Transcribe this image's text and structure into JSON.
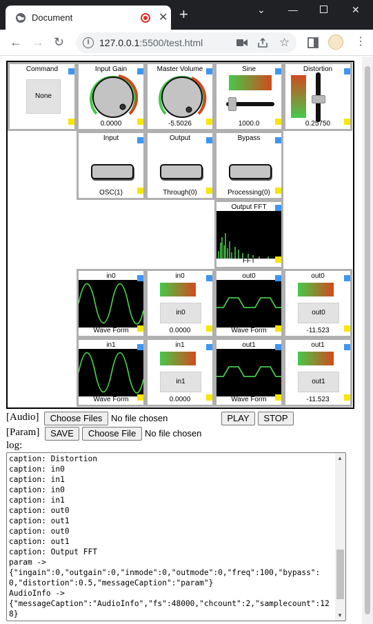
{
  "browser": {
    "tab_title": "Document",
    "url_host": "127.0.0.1",
    "url_rest": ":5500/test.html",
    "new_tab": "+",
    "close": "✕"
  },
  "cells": {
    "command": {
      "caption": "Command",
      "button": "None"
    },
    "input_gain": {
      "caption": "Input Gain",
      "value": "0.0000"
    },
    "master_volume": {
      "caption": "Master Volume",
      "value": "-5.5026"
    },
    "sine": {
      "caption": "Sine",
      "value": "1000.0"
    },
    "distortion": {
      "caption": "Distortion",
      "value": "0.25750"
    },
    "input": {
      "caption": "Input",
      "value": "OSC(1)"
    },
    "output": {
      "caption": "Output",
      "value": "Through(0)"
    },
    "bypass": {
      "caption": "Bypass",
      "value": "Processing(0)"
    },
    "output_fft": {
      "caption": "Output FFT",
      "label": "FFT"
    },
    "in0_wave": {
      "caption": "in0",
      "label": "Wave Form"
    },
    "in0_meter": {
      "caption": "in0",
      "button": "in0",
      "value": "0.0000"
    },
    "out0_wave": {
      "caption": "out0",
      "label": "Wave Form"
    },
    "out0_meter": {
      "caption": "out0",
      "button": "out0",
      "value": "-11.523"
    },
    "in1_wave": {
      "caption": "in1",
      "label": "Wave Form"
    },
    "in1_meter": {
      "caption": "in1",
      "button": "in1",
      "value": "0.0000"
    },
    "out1_wave": {
      "caption": "out1",
      "label": "Wave Form"
    },
    "out1_meter": {
      "caption": "out1",
      "button": "out1",
      "value": "-11.523"
    }
  },
  "controls": {
    "audio_label": "[Audio]",
    "choose_files": "Choose Files",
    "no_file_audio": "No file chosen",
    "play": "PLAY",
    "stop": "STOP",
    "param_label": "[Param]",
    "save": "SAVE",
    "choose_file": "Choose File",
    "no_file_param": "No file chosen"
  },
  "log": {
    "label": "log:",
    "text": "caption: Distortion\ncaption: in0\ncaption: in1\ncaption: in0\ncaption: in1\ncaption: out0\ncaption: out1\ncaption: out0\ncaption: out1\ncaption: Output FFT\nparam ->\n{\"ingain\":0,\"outgain\":0,\"inmode\":0,\"outmode\":0,\"freq\":100,\"bypass\":0,\"distortion\":0.5,\"messageCaption\":\"param\"}\nAudioInfo ->\n{\"messageCaption\":\"AudioInfo\",\"fs\":48000,\"chcount\":2,\"samplecount\":128}"
  }
}
